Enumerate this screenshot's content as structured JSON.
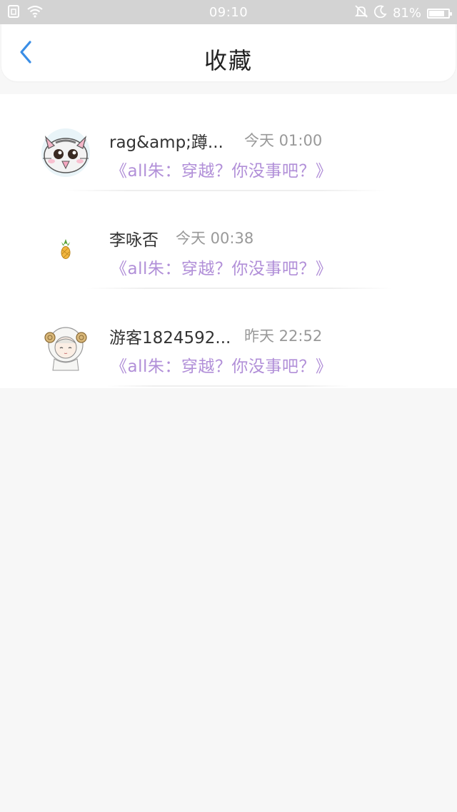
{
  "status_bar": {
    "time": "09:10",
    "battery_text": "81%",
    "battery_level": 0.81,
    "icons": [
      "sim-icon",
      "wifi-icon",
      "mute-icon",
      "moon-icon",
      "battery-icon"
    ]
  },
  "header": {
    "title": "收藏",
    "back_icon": "chevron-left-icon"
  },
  "colors": {
    "accent": "#3a8ee6",
    "book_title": "#b18fd8",
    "name": "#333333",
    "time": "#999999"
  },
  "items": [
    {
      "name": "rag&amp;蹲...",
      "time": "今天 01:00",
      "book": "《all朱：穿越？你没事吧？》",
      "avatar": "cat-avatar"
    },
    {
      "name": "李咏否",
      "time": "今天 00:38",
      "book": "《all朱：穿越？你没事吧？》",
      "avatar": "pineapple-avatar"
    },
    {
      "name": "游客1824592...",
      "time": "昨天 22:52",
      "book": "《all朱：穿越？你没事吧？》",
      "avatar": "sheep-girl-avatar"
    }
  ]
}
